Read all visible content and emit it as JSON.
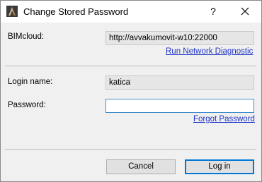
{
  "window": {
    "title": "Change Stored Password",
    "help_label": "?"
  },
  "icons": {
    "app": "archicad-icon",
    "close": "close-icon"
  },
  "server": {
    "label": "BIMcloud:",
    "value": "http://avvakumovit-w10:22000",
    "diagnostic_link": "Run Network Diagnostic"
  },
  "login": {
    "name_label": "Login name:",
    "name_value": "katica",
    "password_label": "Password:",
    "password_value": "",
    "forgot_link": "Forgot Password"
  },
  "buttons": {
    "cancel": "Cancel",
    "login": "Log in"
  },
  "colors": {
    "link": "#1f36c8",
    "focus_border": "#3b8ac9",
    "default_button_border": "#0078d7"
  }
}
